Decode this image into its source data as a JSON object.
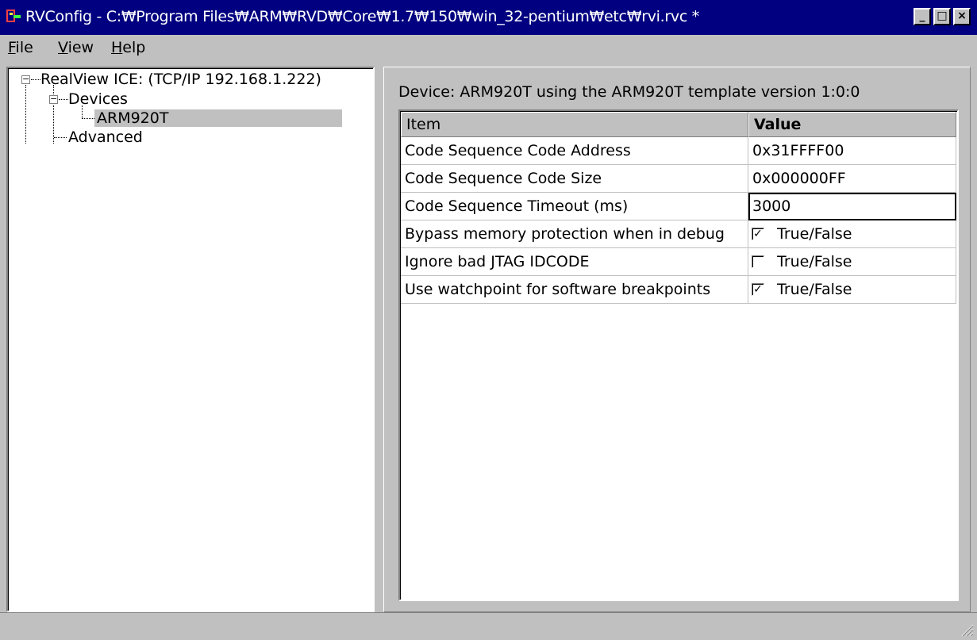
{
  "window": {
    "title": "RVConfig - C:₩Program Files₩ARM₩RVD₩Core₩1.7₩150₩win_32-pentium₩etc₩rvi.rvc *",
    "icons": [
      "app-icon",
      "minimize-icon",
      "maximize-icon",
      "close-icon"
    ]
  },
  "menu": {
    "file": "ile",
    "file_key": "F",
    "view": "iew",
    "view_key": "V",
    "help": "elp",
    "help_key": "H"
  },
  "tree": {
    "root": "RealView ICE: (TCP/IP 192.168.1.222)",
    "devices": "Devices",
    "device": "ARM920T",
    "advanced": "Advanced"
  },
  "device_panel": {
    "label": "Device: ARM920T using the ARM920T template version 1:0:0"
  },
  "grid": {
    "headers": [
      "Item",
      "Value"
    ],
    "rows": [
      {
        "item": "Code Sequence Code Address",
        "value": "0x31FFFF00"
      },
      {
        "item": "Code Sequence Code Size",
        "value": "0x000000FF"
      },
      {
        "item": "Code Sequence Timeout (ms)",
        "value": "3000"
      },
      {
        "item": "Bypass memory protection when in debug",
        "value": "True/False",
        "checked": true
      },
      {
        "item": "Ignore bad JTAG IDCODE",
        "value": "True/False",
        "checked": false
      },
      {
        "item": "Use watchpoint for software breakpoints",
        "value": "True/False",
        "checked": true
      }
    ]
  }
}
